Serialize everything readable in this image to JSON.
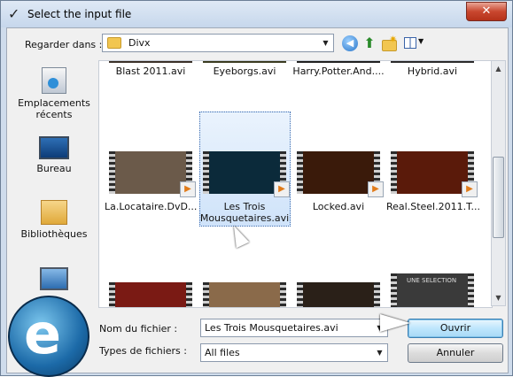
{
  "window": {
    "title": "Select the input file",
    "close_label": "✕"
  },
  "lookin": {
    "label": "Regarder dans :",
    "value": "Divx"
  },
  "places": [
    {
      "label": "Emplacements récents",
      "icon": "recent-places-icon"
    },
    {
      "label": "Bureau",
      "icon": "desktop-icon"
    },
    {
      "label": "Bibliothèques",
      "icon": "libraries-icon"
    },
    {
      "label": "",
      "icon": "computer-icon"
    }
  ],
  "files_top": [
    "Blast 2011.avi",
    "Eyeborgs.avi",
    "Harry.Potter.And....",
    "Hybrid.avi"
  ],
  "files_mid": [
    {
      "name": "La.Locataire.DvD...",
      "color": "#6b5a4a"
    },
    {
      "name": "Les Trois Mousquetaires.avi",
      "color": "#0b2a3a"
    },
    {
      "name": "Locked.avi",
      "color": "#3a1a0a"
    },
    {
      "name": "Real.Steel.2011.T...",
      "color": "#5a1a0a"
    }
  ],
  "files_bottom_colors": [
    "#7a1a14",
    "#8a6a4a",
    "#2a2018",
    "#3a3a3a"
  ],
  "files_bottom_text": [
    "",
    "",
    "",
    "UNE SELECTION"
  ],
  "filename": {
    "label": "Nom du fichier :",
    "value": "Les Trois Mousquetaires.avi"
  },
  "filetype": {
    "label": "Types de fichiers :",
    "value": "All files"
  },
  "buttons": {
    "open": "Ouvrir",
    "cancel": "Annuler"
  }
}
